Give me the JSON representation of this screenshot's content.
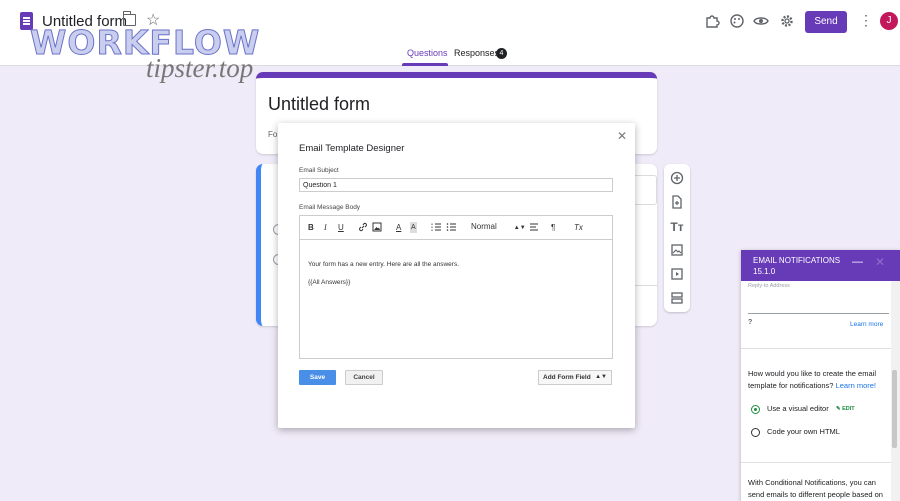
{
  "topbar": {
    "doc_title": "Untitled form",
    "send_label": "Send",
    "avatar_letter": "J",
    "watermark_line1": "WORKFLOW",
    "watermark_line2": "tipster.top"
  },
  "tabs": [
    {
      "label": "Questions",
      "active": true
    },
    {
      "label": "Responses",
      "badge": "4"
    }
  ],
  "form": {
    "title": "Untitled form",
    "desc_partial": "Fo"
  },
  "modal": {
    "title": "Email Template Designer",
    "subject_label": "Email Subject",
    "subject_value": "Question 1",
    "body_label": "Email Message Body",
    "toolbar": {
      "bold": "B",
      "italic": "I",
      "underline": "U",
      "font_color": "A",
      "bg_color": "A",
      "format_select": "Normal",
      "clear": "Tx"
    },
    "body_line1": "Your form has a new entry. Here are all the answers.",
    "body_line2": "{{All Answers}}",
    "save_label": "Save",
    "cancel_label": "Cancel",
    "add_field_label": "Add Form Field"
  },
  "notifications": {
    "title": "EMAIL NOTIFICATIONS 15.1.0",
    "reply_to_placeholder": "Reply-to Address",
    "learn_more": "Learn more",
    "question_text": "How would you like to create the email template for notifications?",
    "question_link": "Learn more!",
    "option_visual": "Use a visual editor",
    "edit_label": "EDIT",
    "option_html": "Code your own HTML",
    "conditional_text": "With Conditional Notifications, you can send emails to different people based on"
  },
  "colors": {
    "brand": "#673ab7",
    "accent_blue": "#4285f4",
    "save_blue": "#4a8fe7",
    "green": "#1e8e3e"
  }
}
